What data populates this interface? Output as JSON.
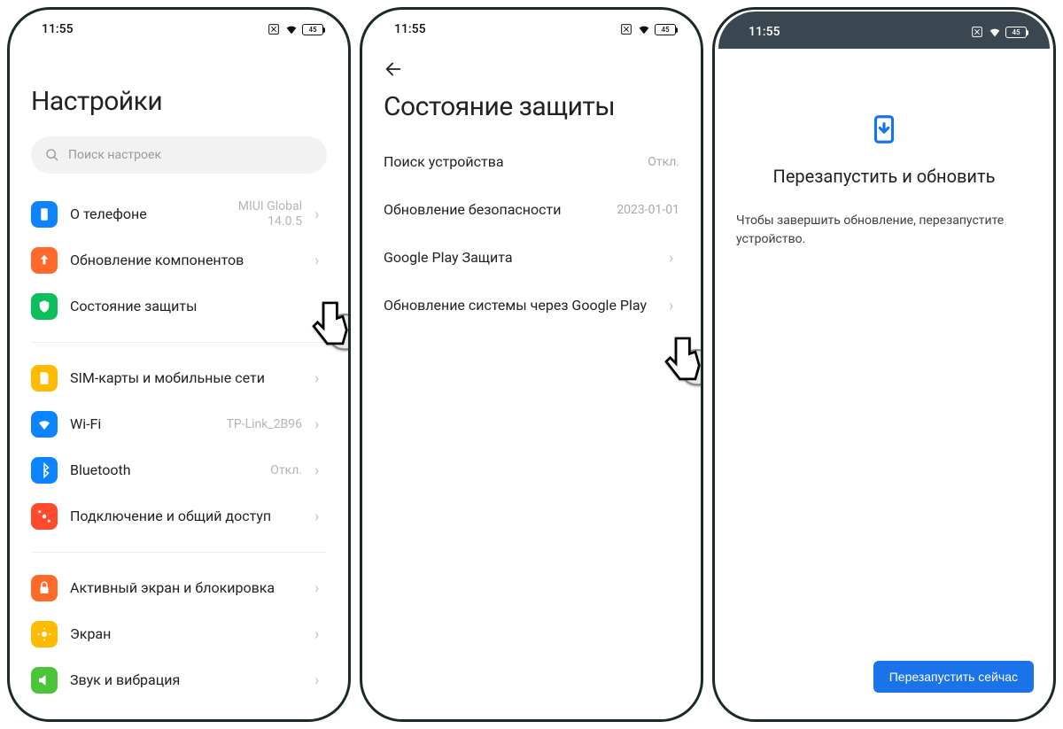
{
  "status": {
    "time": "11:55",
    "battery": "45"
  },
  "screen1": {
    "title": "Настройки",
    "search_placeholder": "Поиск настроек",
    "rows": {
      "about": {
        "label": "О телефоне",
        "value": "MIUI Global\n14.0.5"
      },
      "components": {
        "label": "Обновление компонентов"
      },
      "security": {
        "label": "Состояние защиты"
      },
      "sim": {
        "label": "SIM-карты и мобильные сети"
      },
      "wifi": {
        "label": "Wi-Fi",
        "value": "TP-Link_2B96"
      },
      "bt": {
        "label": "Bluetooth",
        "value": "Откл."
      },
      "share": {
        "label": "Подключение и общий доступ"
      },
      "lock": {
        "label": "Активный экран и блокировка"
      },
      "display": {
        "label": "Экран"
      },
      "sound": {
        "label": "Звук и вибрация"
      }
    }
  },
  "screen2": {
    "title": "Состояние защиты",
    "rows": {
      "find": {
        "label": "Поиск устройства",
        "value": "Откл."
      },
      "secupd": {
        "label": "Обновление безопасности",
        "value": "2023-01-01"
      },
      "play": {
        "label": "Google Play Защита"
      },
      "sysupd": {
        "label": "Обновление системы через Google Play"
      }
    }
  },
  "screen3": {
    "title": "Перезапустить и обновить",
    "body": "Чтобы завершить обновление, перезапустите устройство.",
    "button": "Перезапустить сейчас"
  }
}
